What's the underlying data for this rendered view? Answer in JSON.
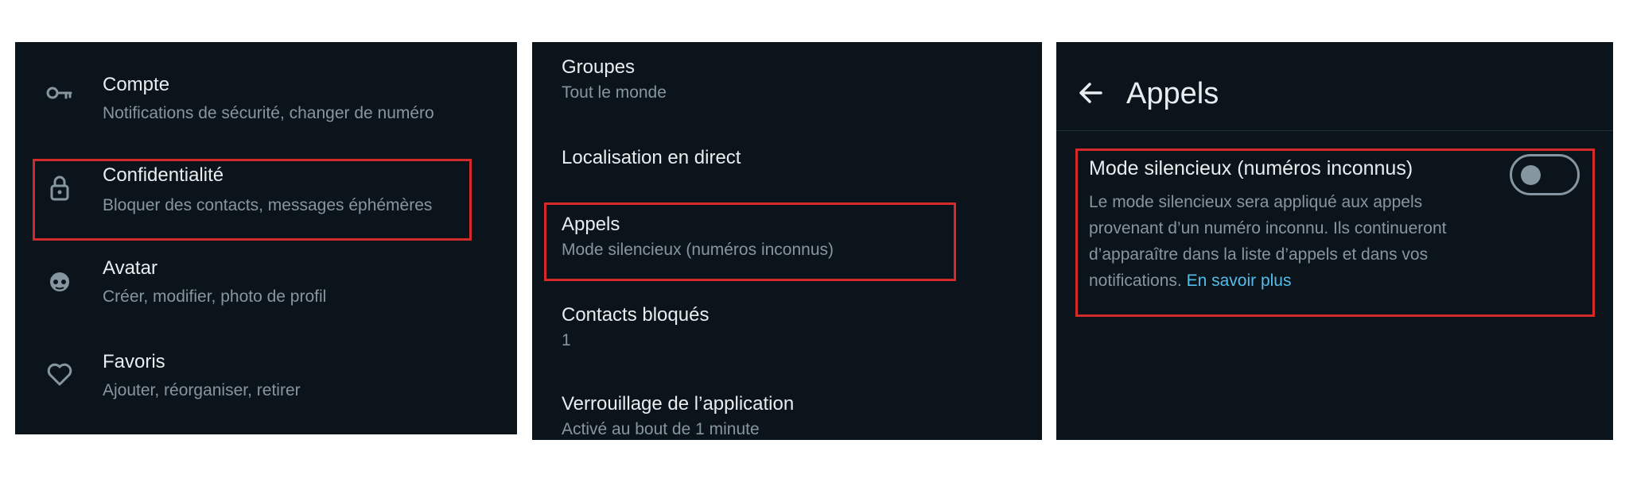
{
  "panel1": {
    "items": [
      {
        "title": "Compte",
        "subtitle": "Notifications de sécurité, changer de numéro",
        "icon": "key-icon"
      },
      {
        "title": "Confidentialité",
        "subtitle": "Bloquer des contacts, messages éphémères",
        "icon": "lock-icon"
      },
      {
        "title": "Avatar",
        "subtitle": "Créer, modifier, photo de profil",
        "icon": "avatar-icon"
      },
      {
        "title": "Favoris",
        "subtitle": "Ajouter, réorganiser, retirer",
        "icon": "heart-icon"
      }
    ],
    "highlighted_index": 1
  },
  "panel2": {
    "items": [
      {
        "title": "Groupes",
        "subtitle": "Tout le monde"
      },
      {
        "title": "Localisation en direct",
        "subtitle": ""
      },
      {
        "title": "Appels",
        "subtitle": "Mode silencieux (numéros inconnus)"
      },
      {
        "title": "Contacts bloqués",
        "subtitle": "1"
      },
      {
        "title": "Verrouillage de l’application",
        "subtitle": "Activé au bout de 1 minute"
      }
    ],
    "highlighted_index": 2
  },
  "panel3": {
    "back_icon": "back-arrow-icon",
    "header_title": "Appels",
    "setting": {
      "title": "Mode silencieux (numéros inconnus)",
      "description": "Le mode silencieux sera appliqué aux appels provenant d’un numéro inconnu. Ils continueront d’apparaître dans la liste d’appels et dans vos notifications.",
      "link": "En savoir plus",
      "enabled": false
    }
  },
  "colors": {
    "background": "#0b141a",
    "text_primary": "#e9edef",
    "text_secondary": "#8696a0",
    "link": "#53bdeb",
    "highlight_border": "#d42a2a"
  }
}
